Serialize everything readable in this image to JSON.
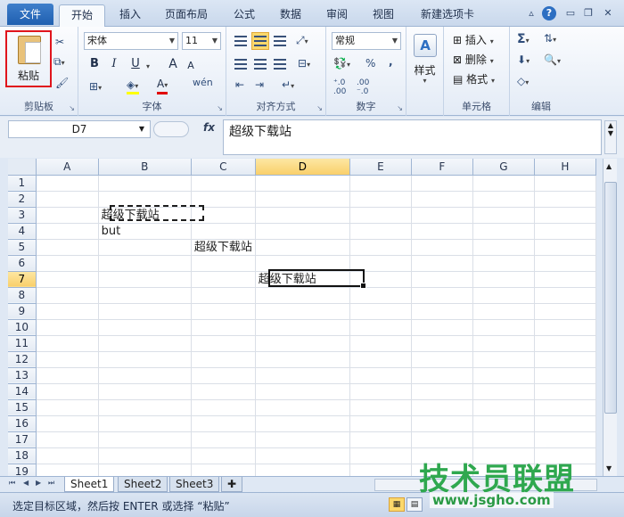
{
  "tabs": {
    "file": "文件",
    "items": [
      "开始",
      "插入",
      "页面布局",
      "公式",
      "数据",
      "审阅",
      "视图",
      "新建选项卡"
    ]
  },
  "window_controls": [
    "minimize-ribbon",
    "help",
    "minimize",
    "restore",
    "close"
  ],
  "ribbon": {
    "clipboard": {
      "label": "剪贴板",
      "paste": "粘贴"
    },
    "font": {
      "label": "字体",
      "name": "宋体",
      "size": "11",
      "bold": "B",
      "italic": "I",
      "underline": "U",
      "grow": "A",
      "shrink": "A",
      "fill_color": "#ffff00",
      "font_color": "#e00000",
      "wen": "wén"
    },
    "alignment": {
      "label": "对齐方式"
    },
    "number": {
      "label": "数字",
      "format": "常规",
      "percent": "%",
      "comma": ",",
      "inc_decimal": ".0\n.00",
      "dec_decimal": ".00\n.0"
    },
    "styles": {
      "label": "样式"
    },
    "cells": {
      "label": "单元格",
      "insert": "插入",
      "delete": "删除",
      "format": "格式"
    },
    "editing": {
      "label": "编辑",
      "sum": "Σ"
    }
  },
  "formula_bar": {
    "name_box": "D7",
    "fx": "fx",
    "content": "超级下载站"
  },
  "grid": {
    "columns": [
      "A",
      "B",
      "C",
      "D",
      "E",
      "F",
      "G",
      "H"
    ],
    "rows": [
      "1",
      "2",
      "3",
      "4",
      "5",
      "6",
      "7",
      "8",
      "9",
      "10",
      "11",
      "12",
      "13",
      "14",
      "15",
      "16",
      "17",
      "18",
      "19"
    ],
    "selected_column": "D",
    "selected_row": "7",
    "cells": {
      "B3": "超级下载站",
      "B4": "but",
      "C5": "超级下载站",
      "D7": "超级下载站"
    }
  },
  "sheet_tabs": [
    "Sheet1",
    "Sheet2",
    "Sheet3"
  ],
  "active_sheet": "Sheet1",
  "status_bar": {
    "message": "选定目标区域，然后按 ENTER 或选择 “粘贴”"
  },
  "watermark": {
    "title": "技术员联盟",
    "url": "www.jsgho.com"
  }
}
